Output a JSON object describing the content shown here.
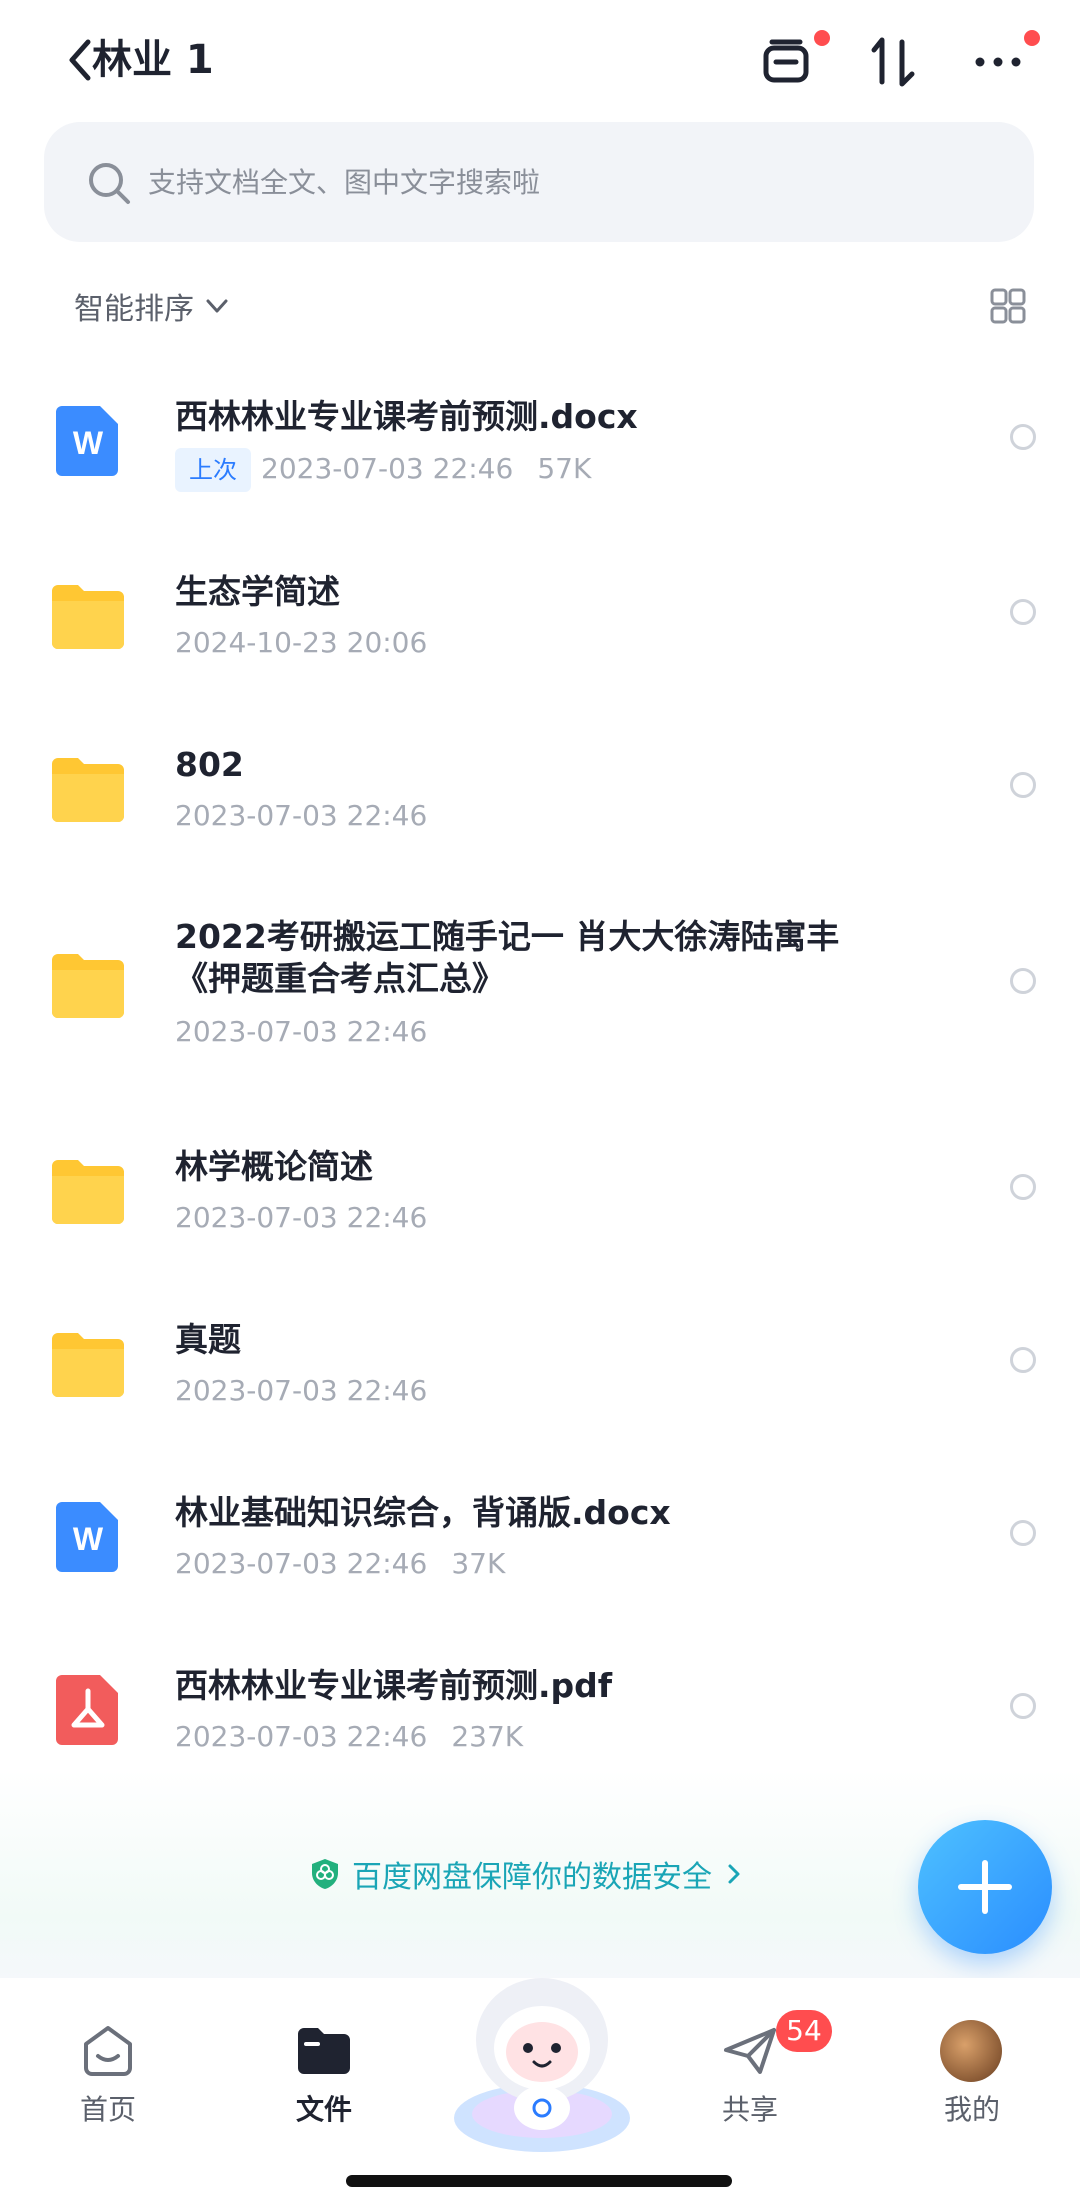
{
  "header": {
    "title": "林业 1",
    "back_icon": "chevron-left-icon",
    "actions": [
      {
        "icon": "transfer-list-icon",
        "has_dot": true
      },
      {
        "icon": "sort-arrows-icon",
        "has_dot": false
      },
      {
        "icon": "more-icon",
        "has_dot": true
      }
    ]
  },
  "search": {
    "placeholder": "支持文档全文、图中文字搜索啦"
  },
  "sort": {
    "label": "智能排序",
    "view_toggle_icon": "grid-view-icon"
  },
  "files": [
    {
      "name": "西林林业专业课考前预测.docx",
      "type": "word",
      "tag": "上次",
      "date": "2023-07-03 22:46",
      "size": "57K"
    },
    {
      "name": "生态学简述",
      "type": "folder",
      "date": "2024-10-23 20:06"
    },
    {
      "name": "802",
      "type": "folder",
      "date": "2023-07-03 22:46"
    },
    {
      "name_line1": "2022考研搬运工随手记一 肖大大徐涛陆寓丰",
      "name_line2": "《押题重合考点汇总》",
      "type": "folder",
      "date": "2023-07-03 22:46"
    },
    {
      "name": "林学概论简述",
      "type": "folder",
      "date": "2023-07-03 22:46"
    },
    {
      "name": "真题",
      "type": "folder",
      "date": "2023-07-03 22:46"
    },
    {
      "name": "林业基础知识综合，背诵版.docx",
      "type": "word",
      "date": "2023-07-03 22:46",
      "size": "37K"
    },
    {
      "name": "西林林业专业课考前预测.pdf",
      "type": "pdf",
      "date": "2023-07-03 22:46",
      "size": "237K"
    }
  ],
  "banner": {
    "text": "百度网盘保障你的数据安全"
  },
  "nav": {
    "items": [
      {
        "label": "首页",
        "icon": "home-icon"
      },
      {
        "label": "文件",
        "icon": "folder-icon",
        "active": true
      },
      {
        "label": "",
        "icon": "mascot-icon"
      },
      {
        "label": "共享",
        "icon": "share-icon",
        "badge": "54"
      },
      {
        "label": "我的",
        "icon": "avatar"
      }
    ]
  },
  "colors": {
    "accent": "#2b7cff",
    "folder": "#ffc733",
    "word": "#3b8cff",
    "pdf": "#f25c5c",
    "badge": "#ff4d4f",
    "banner_text": "#1aa5b6"
  }
}
